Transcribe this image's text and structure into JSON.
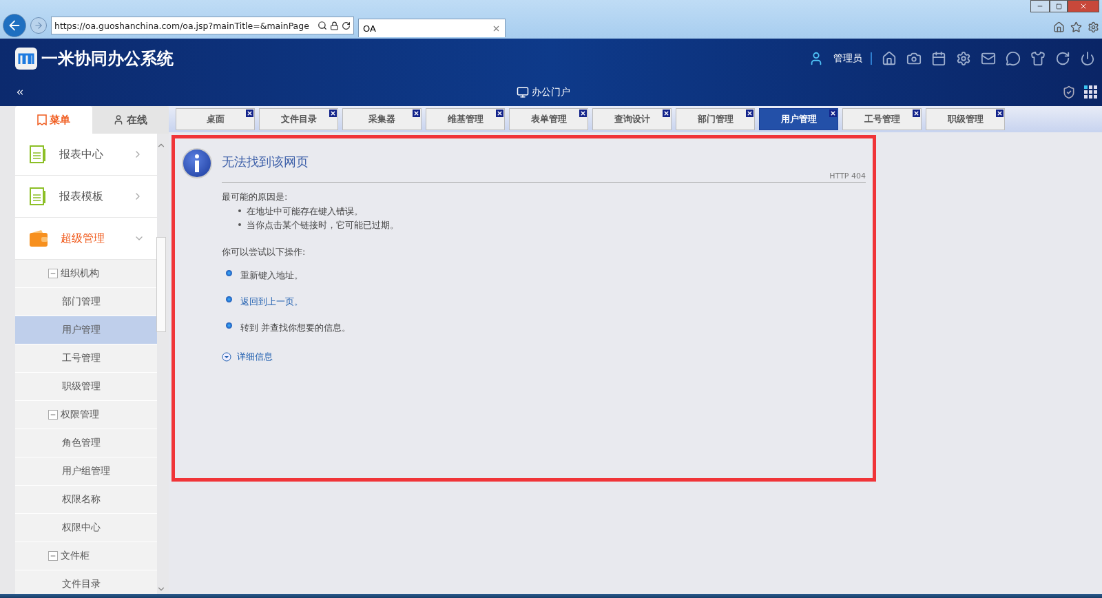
{
  "browser": {
    "url": "https://oa.guoshanchina.com/oa.jsp?mainTitle=&mainPage",
    "tab_title": "OA"
  },
  "header": {
    "title": "一米协同办公系统",
    "user": "管理员",
    "portal": "办公门户"
  },
  "sidebar": {
    "tabs": [
      {
        "label": "菜单",
        "selected": true
      },
      {
        "label": "在线",
        "selected": false
      }
    ],
    "items": [
      {
        "label": "报表中心",
        "kind": "report",
        "expanded": false
      },
      {
        "label": "报表模板",
        "kind": "report",
        "expanded": false
      },
      {
        "label": "超级管理",
        "kind": "wallet",
        "expanded": true,
        "children": [
          {
            "label": "组织机构",
            "expanded": true,
            "children": [
              {
                "label": "部门管理",
                "selected": false
              },
              {
                "label": "用户管理",
                "selected": true
              },
              {
                "label": "工号管理",
                "selected": false
              },
              {
                "label": "职级管理",
                "selected": false
              }
            ]
          },
          {
            "label": "权限管理",
            "expanded": true,
            "children": [
              {
                "label": "角色管理",
                "selected": false
              },
              {
                "label": "用户组管理",
                "selected": false
              },
              {
                "label": "权限名称",
                "selected": false
              },
              {
                "label": "权限中心",
                "selected": false
              }
            ]
          },
          {
            "label": "文件柜",
            "expanded": true,
            "children": [
              {
                "label": "文件目录",
                "selected": false
              }
            ]
          }
        ]
      }
    ]
  },
  "page_tabs": [
    {
      "label": "桌面",
      "selected": false
    },
    {
      "label": "文件目录",
      "selected": false
    },
    {
      "label": "采集器",
      "selected": false
    },
    {
      "label": "维基管理",
      "selected": false
    },
    {
      "label": "表单管理",
      "selected": false
    },
    {
      "label": "查询设计",
      "selected": false
    },
    {
      "label": "部门管理",
      "selected": false
    },
    {
      "label": "用户管理",
      "selected": true
    },
    {
      "label": "工号管理",
      "selected": false
    },
    {
      "label": "职级管理",
      "selected": false
    }
  ],
  "error_page": {
    "title": "无法找到该网页",
    "code": "HTTP 404",
    "causes_heading": "最可能的原因是:",
    "causes": [
      "在地址中可能存在键入错误。",
      "当你点击某个链接时，它可能已过期。"
    ],
    "try_heading": "你可以尝试以下操作:",
    "actions": [
      {
        "text": "重新键入地址。",
        "kind": "text"
      },
      {
        "text": "返回到上一页。",
        "kind": "link"
      },
      {
        "text": "转到  并查找你想要的信息。",
        "kind": "text"
      }
    ],
    "details": "详细信息"
  }
}
